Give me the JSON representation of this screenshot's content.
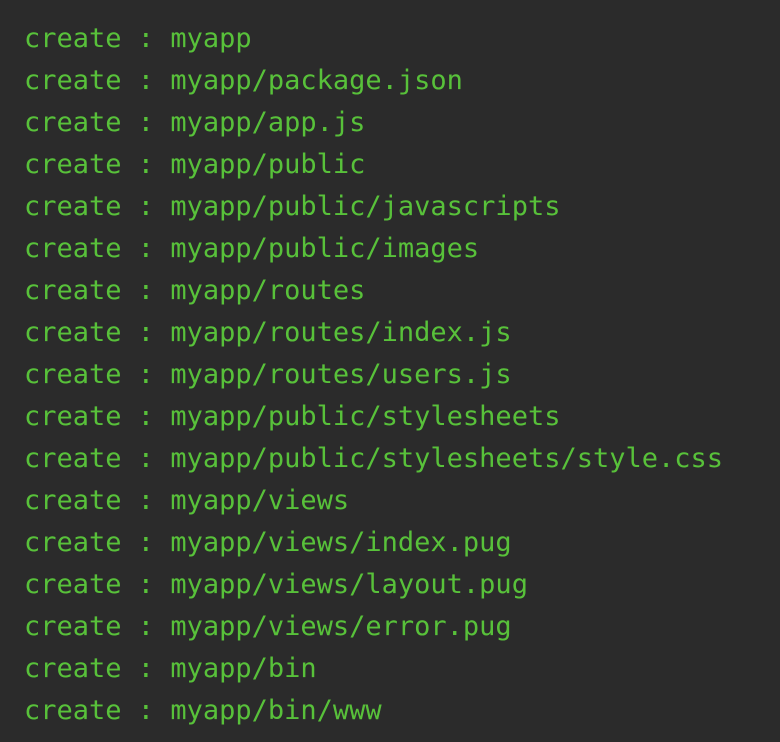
{
  "terminal": {
    "lines": [
      {
        "cmd": "create",
        "sep": " : ",
        "path": "myapp"
      },
      {
        "cmd": "create",
        "sep": " : ",
        "path": "myapp/package.json"
      },
      {
        "cmd": "create",
        "sep": " : ",
        "path": "myapp/app.js"
      },
      {
        "cmd": "create",
        "sep": " : ",
        "path": "myapp/public"
      },
      {
        "cmd": "create",
        "sep": " : ",
        "path": "myapp/public/javascripts"
      },
      {
        "cmd": "create",
        "sep": " : ",
        "path": "myapp/public/images"
      },
      {
        "cmd": "create",
        "sep": " : ",
        "path": "myapp/routes"
      },
      {
        "cmd": "create",
        "sep": " : ",
        "path": "myapp/routes/index.js"
      },
      {
        "cmd": "create",
        "sep": " : ",
        "path": "myapp/routes/users.js"
      },
      {
        "cmd": "create",
        "sep": " : ",
        "path": "myapp/public/stylesheets"
      },
      {
        "cmd": "create",
        "sep": " : ",
        "path": "myapp/public/stylesheets/style.css"
      },
      {
        "cmd": "create",
        "sep": " : ",
        "path": "myapp/views"
      },
      {
        "cmd": "create",
        "sep": " : ",
        "path": "myapp/views/index.pug"
      },
      {
        "cmd": "create",
        "sep": " : ",
        "path": "myapp/views/layout.pug"
      },
      {
        "cmd": "create",
        "sep": " : ",
        "path": "myapp/views/error.pug"
      },
      {
        "cmd": "create",
        "sep": " : ",
        "path": "myapp/bin"
      },
      {
        "cmd": "create",
        "sep": " : ",
        "path": "myapp/bin/www"
      }
    ]
  },
  "colors": {
    "background": "#2b2b2b",
    "text": "#58c13a"
  }
}
